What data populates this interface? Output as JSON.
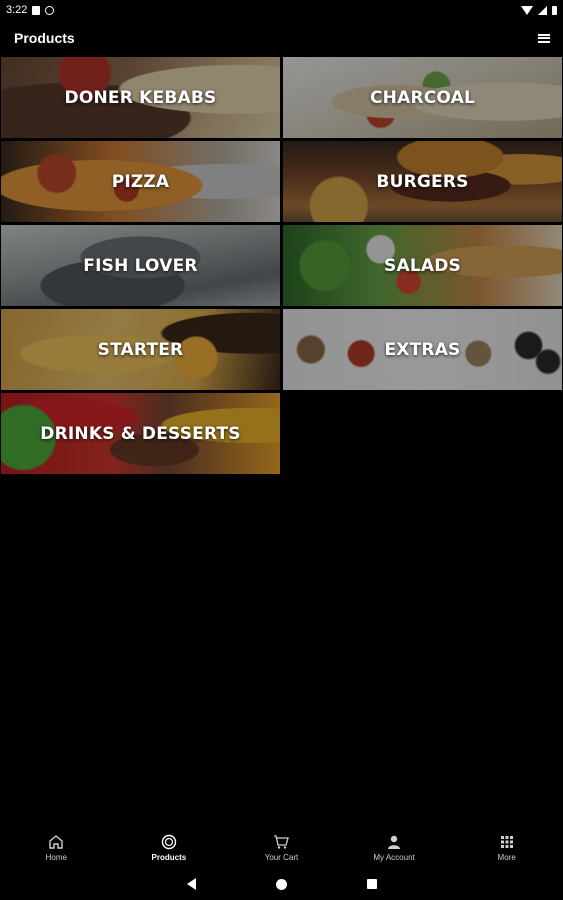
{
  "status_bar": {
    "time": "3:22",
    "icons": [
      "notification-square-icon",
      "notification-circle-icon",
      "wifi-icon",
      "signal-icon",
      "battery-icon"
    ]
  },
  "app_bar": {
    "title": "Products",
    "view_toggle_icon": "list-icon"
  },
  "categories": [
    {
      "label": "DONER KEBABS"
    },
    {
      "label": "CHARCOAL"
    },
    {
      "label": "PIZZA"
    },
    {
      "label": "BURGERS"
    },
    {
      "label": "FISH LOVER"
    },
    {
      "label": "SALADS"
    },
    {
      "label": "STARTER"
    },
    {
      "label": "EXTRAS"
    },
    {
      "label": "DRINKS & DESSERTS"
    }
  ],
  "bottom_nav": {
    "active": "Products",
    "items": [
      {
        "label": "Home",
        "icon": "home-icon"
      },
      {
        "label": "Products",
        "icon": "products-icon"
      },
      {
        "label": "Your Cart",
        "icon": "cart-icon"
      },
      {
        "label": "My Account",
        "icon": "account-icon"
      },
      {
        "label": "More",
        "icon": "grid-icon"
      }
    ]
  },
  "system_nav": {
    "buttons": [
      "back-icon",
      "home-circle-icon",
      "recents-icon"
    ]
  },
  "colors": {
    "background": "#000000",
    "text": "#ffffff",
    "nav_inactive": "#cfcfcf"
  }
}
